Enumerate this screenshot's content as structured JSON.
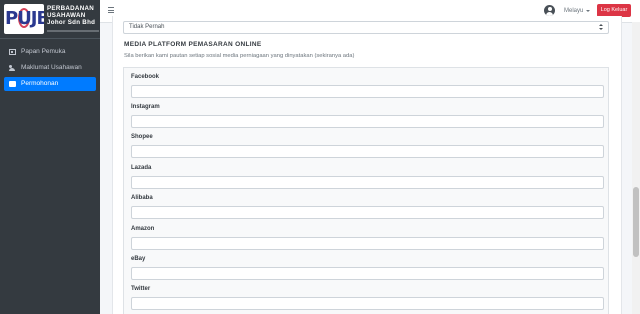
{
  "brand": {
    "logo_text": "PUJB",
    "name_lines": [
      "PERBADANAN",
      "USAHAWAN",
      "Johor Sdn Bhd"
    ]
  },
  "sidebar": {
    "items": [
      {
        "label": "Papan Pemuka",
        "icon": "dashboard-icon",
        "active": false
      },
      {
        "label": "Maklumat Usahawan",
        "icon": "user-icon",
        "active": false
      },
      {
        "label": "Permohonan",
        "icon": "document-icon",
        "active": true
      }
    ]
  },
  "navbar": {
    "language": "Melayu",
    "logout_label": "Log Keluar"
  },
  "form": {
    "previous_select_value": "Tidak Pernah",
    "section_title": "MEDIA PLATFORM PEMASARAN ONLINE",
    "section_hint": "Sila berikan kami pautan setiap sosial media perniagaan yang dinyatakan (sekiranya ada)",
    "fields": [
      {
        "label": "Facebook",
        "value": ""
      },
      {
        "label": "Instagram",
        "value": ""
      },
      {
        "label": "Shopee",
        "value": ""
      },
      {
        "label": "Lazada",
        "value": ""
      },
      {
        "label": "Alibaba",
        "value": ""
      },
      {
        "label": "Amazon",
        "value": ""
      },
      {
        "label": "eBay",
        "value": ""
      },
      {
        "label": "Twitter",
        "value": ""
      }
    ]
  },
  "colors": {
    "sidebar_bg": "#343a40",
    "active_item": "#007bff",
    "logout_button": "#dc3545"
  }
}
